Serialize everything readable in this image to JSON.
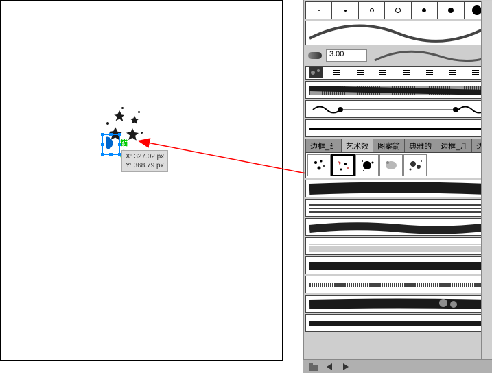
{
  "canvas": {
    "anchor_label": "锚点",
    "tooltip_x": "X: 327.02 px",
    "tooltip_y": "Y: 368.79 px"
  },
  "panel": {
    "brush_size": "3.00",
    "tabs": [
      {
        "label": "边框_纟"
      },
      {
        "label": "艺术效"
      },
      {
        "label": "图案箭"
      },
      {
        "label": "典雅的"
      },
      {
        "label": "边框_几"
      },
      {
        "label": "边框_釒"
      }
    ]
  }
}
